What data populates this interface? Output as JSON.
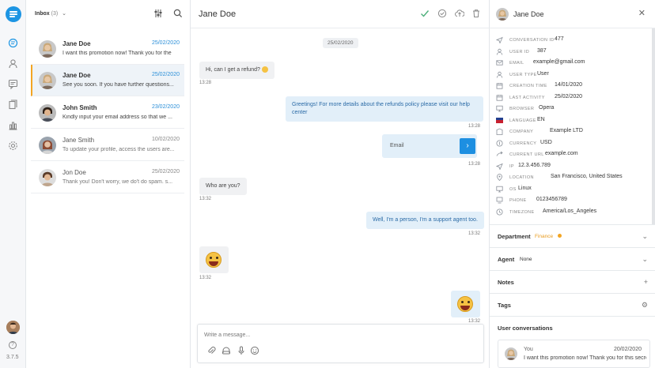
{
  "app": {
    "version": "3.7.5"
  },
  "list": {
    "inbox_label": "Inbox",
    "inbox_count": "(3)",
    "items": [
      {
        "name": "Jane Doe",
        "date": "25/02/2020",
        "preview": "I want this promotion now! Thank you for the",
        "avatar": {
          "skin": "#d9b38c",
          "hair": "#c9a879"
        }
      },
      {
        "name": "Jane Doe",
        "date": "25/02/2020",
        "preview": "See you soon. If you have further questions...",
        "avatar": {
          "skin": "#d9b38c",
          "hair": "#c9a879"
        }
      },
      {
        "name": "John Smith",
        "date": "23/02/2020",
        "preview": "Kindly input your email address so that we ...",
        "avatar": {
          "skin": "#e0b48e",
          "hair": "#2c1f17"
        }
      },
      {
        "name": "Jane Smith",
        "date": "10/02/2020",
        "preview": "To update your profile, access the users are...",
        "avatar": {
          "skin": "#e5c1a5",
          "hair": "#8c4a33"
        }
      },
      {
        "name": "Jon Doe",
        "date": "25/02/2020",
        "preview": "Thank you! Don't worry, we do't do spam. s...",
        "avatar": {
          "skin": "#e3b894",
          "hair": "#5a3b28"
        }
      }
    ]
  },
  "chat": {
    "title": "Jane Doe",
    "day_separator": "25/02/2020",
    "messages": [
      {
        "text": "Hi, can I get a refund?",
        "time": "13:28"
      },
      {
        "text": "Greetings! For more details about the refunds policy please visit our help center",
        "time": "13:28"
      },
      {
        "email_label": "Email",
        "time": "13:28"
      },
      {
        "text": "Who are you?",
        "time": "13:32"
      },
      {
        "text": "Well, I'm a person, I'm a support agent too.",
        "time": "13:32"
      },
      {
        "time": "13:32"
      },
      {
        "time": "13:32"
      }
    ],
    "composer_placeholder": "Write a message..."
  },
  "details": {
    "name": "Jane Doe",
    "fields": [
      {
        "icon": "send-icon",
        "key": "Conversation ID",
        "value": "477"
      },
      {
        "icon": "user-icon",
        "key": "User ID",
        "value": "387"
      },
      {
        "icon": "mail-icon",
        "key": "Email",
        "value": "example@gmail.com"
      },
      {
        "icon": "user-icon",
        "key": "User type",
        "value": "User"
      },
      {
        "icon": "calendar-icon",
        "key": "Creation time",
        "value": "14/01/2020"
      },
      {
        "icon": "calendar-icon",
        "key": "Last activity",
        "value": "25/02/2020"
      },
      {
        "icon": "monitor-icon",
        "key": "Browser",
        "value": "Opera"
      },
      {
        "icon": "flag-icon",
        "key": "Language",
        "value": "EN"
      },
      {
        "icon": "building-icon",
        "key": "Company",
        "value": "Example LTD"
      },
      {
        "icon": "currency-icon",
        "key": "Currency",
        "value": "USD"
      },
      {
        "icon": "link-icon",
        "key": "Current URL",
        "value": "example.com"
      },
      {
        "icon": "send-icon",
        "key": "IP",
        "value": "12.3.456.789"
      },
      {
        "icon": "pin-icon",
        "key": "Location",
        "value": "San Francisco, United States"
      },
      {
        "icon": "monitor-icon",
        "key": "OS",
        "value": "Linux"
      },
      {
        "icon": "phone-icon",
        "key": "Phone",
        "value": "0123456789"
      },
      {
        "icon": "clock-icon",
        "key": "Timezone",
        "value": "America/Los_Angeles"
      }
    ],
    "sections": {
      "department": {
        "label": "Department",
        "value": "Finance"
      },
      "agent": {
        "label": "Agent",
        "value": "None"
      },
      "notes": {
        "label": "Notes"
      },
      "tags": {
        "label": "Tags"
      },
      "user_conversations": {
        "label": "User conversations"
      }
    },
    "user_conversation": {
      "name": "You",
      "date": "20/02/2020",
      "preview": "I want this promotion now! Thank you for this secret ..."
    }
  },
  "colors": {
    "accent": "#1d95e3",
    "active_border": "#f3a523",
    "agent_bubble": "#e2eff9"
  }
}
